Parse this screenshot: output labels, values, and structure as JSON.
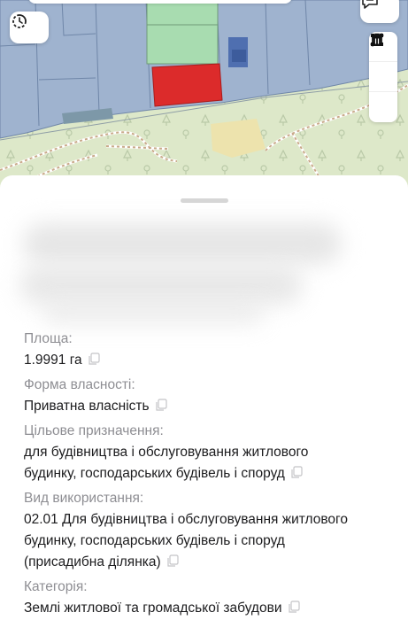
{
  "map": {
    "icons": {
      "history": "history-clock-icon",
      "chat": "chat-bubble-icon",
      "measure_distance": "ruler-line-icon",
      "measure_area": "square-area-icon",
      "delete": "trash-icon"
    },
    "colors": {
      "selected_parcel": "#dc2b2b",
      "parcel_green": "#a8dcb0",
      "parcel_blue": "#9fb3cf",
      "forest": "#dde8c9"
    }
  },
  "sheet": {
    "fields": [
      {
        "label": "Площа:",
        "value": "1.9991 га"
      },
      {
        "label": "Форма власності:",
        "value": "Приватна власність"
      },
      {
        "label": "Цільове призначення:",
        "value": "для будівництва і обслуговування житлового\nбудинку, господарських будівель і споруд"
      },
      {
        "label": "Вид використання:",
        "value": "02.01 Для будівництва і обслуговування житлового\nбудинку, господарських будівель і споруд\n(присадибна ділянка)"
      },
      {
        "label": "Категорія:",
        "value": "Землі житлової та громадської забудови"
      }
    ]
  }
}
